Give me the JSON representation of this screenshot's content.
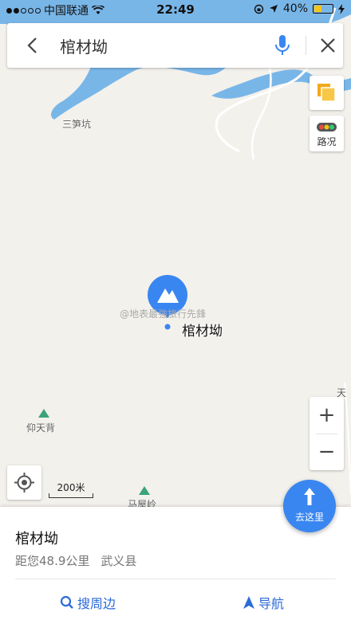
{
  "status_bar": {
    "carrier": "中国联通",
    "time": "22:49",
    "battery": "40%",
    "battery_level": 0.4
  },
  "search": {
    "query": "棺材坳"
  },
  "map": {
    "labels": {
      "sanyukeng": "三笋坑",
      "yangtianbei": "仰天背",
      "mawuling": "马屋岭",
      "tian": "天"
    },
    "pin_label": "棺材坳",
    "watermark": "@地表最強旅行先鋒",
    "scale": "200米",
    "traffic_label": "路况",
    "zoom_in": "+",
    "zoom_out": "−"
  },
  "goto_button": {
    "label": "去这里"
  },
  "panel": {
    "title": "棺材坳",
    "distance": "距您48.9公里",
    "county": "武义县",
    "search_nearby": "搜周边",
    "navigate": "导航"
  },
  "colors": {
    "water": "#79b6e8",
    "road": "#ffffff",
    "accent": "#3a86f0",
    "land": "#f3f1ec"
  }
}
